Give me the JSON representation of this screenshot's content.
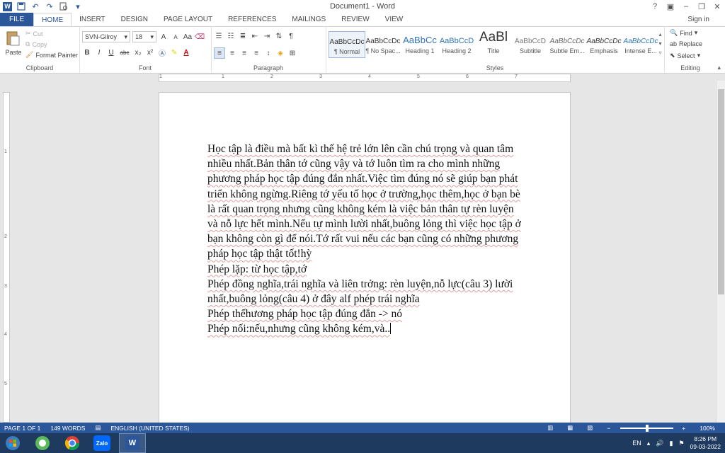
{
  "window": {
    "title": "Document1 - Word"
  },
  "qat": {
    "undo": "↶",
    "redo": "↷"
  },
  "tabs": [
    "FILE",
    "HOME",
    "INSERT",
    "DESIGN",
    "PAGE LAYOUT",
    "REFERENCES",
    "MAILINGS",
    "REVIEW",
    "VIEW"
  ],
  "active_tab": "HOME",
  "sign_in": "Sign in",
  "clipboard": {
    "paste": "Paste",
    "cut": "Cut",
    "copy": "Copy",
    "format_painter": "Format Painter",
    "label": "Clipboard"
  },
  "font": {
    "name": "SVN-Gilroy",
    "size": "18",
    "label": "Font",
    "bold": "B",
    "italic": "I",
    "underline": "U",
    "strike": "abc",
    "sub": "x₂",
    "sup": "x²",
    "grow": "A",
    "shrink": "A",
    "case": "Aa"
  },
  "paragraph": {
    "label": "Paragraph"
  },
  "styles": {
    "label": "Styles",
    "items": [
      {
        "preview": "AaBbCcDc",
        "name": "¶ Normal"
      },
      {
        "preview": "AaBbCcDc",
        "name": "¶ No Spac..."
      },
      {
        "preview": "AaBbCc",
        "name": "Heading 1"
      },
      {
        "preview": "AaBbCcD",
        "name": "Heading 2"
      },
      {
        "preview": "AaBl",
        "name": "Title"
      },
      {
        "preview": "AaBbCcD",
        "name": "Subtitle"
      },
      {
        "preview": "AaBbCcDc",
        "name": "Subtle Em..."
      },
      {
        "preview": "AaBbCcDc",
        "name": "Emphasis"
      },
      {
        "preview": "AaBbCcDc",
        "name": "Intense E..."
      }
    ]
  },
  "editing": {
    "label": "Editing",
    "find": "Find",
    "replace": "Replace",
    "select": "Select"
  },
  "ruler_ticks": [
    "1",
    "1",
    "2",
    "3",
    "4",
    "5",
    "6",
    "7"
  ],
  "vruler_ticks": [
    "1",
    "2",
    "3",
    "4",
    "5"
  ],
  "document": {
    "paragraphs": [
      "Học tập là điều mà bất kì thế hệ trẻ lớn lên cần chú trọng và quan tâm nhiều nhất.Bản thân tớ cũng vậy và tớ luôn tìm ra cho mình những phương pháp học tập đúng đắn nhất.Việc tìm đúng nó sẽ giúp bạn phát triển không ngừng.Riêng tớ yếu tố học ở trường,học thêm,học ở bạn bè là rất quan trọng nhưng cũng không kém là việc bản thân tự rèn luyện và nỗ lực hết mình.Nếu tự mình lười nhất,buông lỏng thì việc học tập ở bạn không còn gì để nói.Tớ rất vui nếu các bạn cũng có những phương pháp học tập thật tốt!hỳ",
      "Phép lặp: từ học tập,tớ",
      "Phép đồng nghĩa,trái nghĩa và liên trởng: rèn luyện,nỗ lực(câu 3) lười nhất,buông lỏng(câu 4) ở đây alf phép trái nghĩa",
      "Phép thếhương pháp học tập đúng đắn -> nó",
      "Phép nối:nếu,nhưng cũng không kém,và.."
    ]
  },
  "status": {
    "page": "PAGE 1 OF 1",
    "words": "149 WORDS",
    "language": "ENGLISH (UNITED STATES)",
    "zoom": "100%",
    "zoom_minus": "−",
    "zoom_plus": "+"
  },
  "taskbar": {
    "lang": "EN",
    "time": "8:26 PM",
    "date": "09-03-2022",
    "apps": [
      {
        "icon": "windows-start-icon"
      },
      {
        "icon": "mascot-app-icon"
      },
      {
        "icon": "chrome-icon"
      },
      {
        "icon": "zalo-icon",
        "label": "Zalo"
      },
      {
        "icon": "word-icon",
        "label": "W"
      }
    ]
  },
  "colors": {
    "accent": "#2b579a",
    "taskbar": "#1e3a5f"
  }
}
